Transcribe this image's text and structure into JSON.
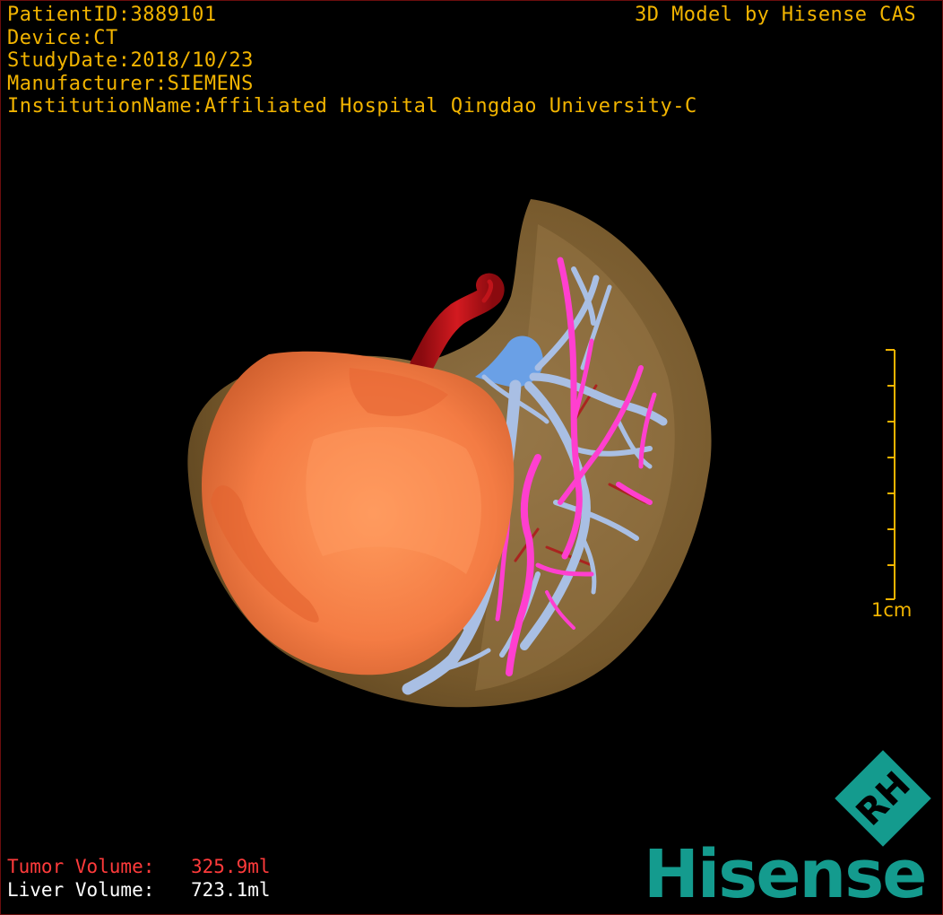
{
  "patient_info": {
    "patient_id": "PatientID:3889101",
    "device": "Device:CT",
    "study_date": "StudyDate:2018/10/23",
    "manufacturer": "Manufacturer:SIEMENS",
    "institution": "InstitutionName:Affiliated Hospital Qingdao University-C"
  },
  "brand_caption": "3D Model by Hisense CAS",
  "scale": {
    "label": "1cm"
  },
  "volumes": {
    "tumor_label": "Tumor Volume:",
    "tumor_value": "325.9ml",
    "liver_label": "Liver Volume:",
    "liver_value": "723.1ml"
  },
  "logo": {
    "emblem_text": "RH",
    "wordmark": "Hisense",
    "color": "#149b8e"
  },
  "colors": {
    "overlay_text": "#f2b400",
    "tumor_text": "#ff3b3b",
    "liver_text": "#ffffff",
    "liver": "#8c6a3e",
    "tumor": "#f37a45",
    "portal_vein": "#9fb8e0",
    "hepatic_vein": "#ff3fcf",
    "artery": "#c0141a"
  }
}
